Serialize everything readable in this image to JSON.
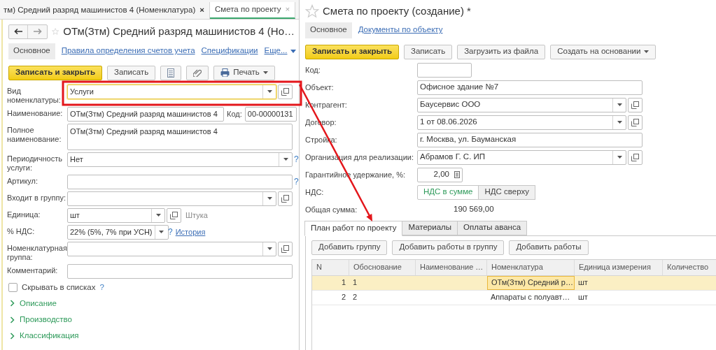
{
  "tab_bar": [
    {
      "label": "тм) Средний разряд машинистов 4 (Номенклатура)",
      "close": "×",
      "selected": false
    },
    {
      "label": "Смета по проекту",
      "close": "×",
      "selected": true
    }
  ],
  "left_form": {
    "title": "ОТм(Зтм) Средний разряд машинистов 4 (Но…",
    "nav": [
      {
        "label": "Основное",
        "selected": true
      },
      {
        "label": "Правила определения счетов учета",
        "selected": false
      },
      {
        "label": "Спецификации",
        "selected": false
      },
      {
        "label": "Еще...",
        "selected": false
      }
    ],
    "toolbar": [
      {
        "kind": "primary",
        "label": "Записать и закрыть"
      },
      {
        "kind": "plain",
        "label": "Записать"
      },
      {
        "kind": "list_icon"
      },
      {
        "kind": "clip_icon"
      },
      {
        "kind": "print",
        "label": "Печать"
      }
    ],
    "fields": [
      {
        "kind": "full",
        "label": "Вид номенклатуры:",
        "value": "Услуги",
        "dropdown": true,
        "open_button": true,
        "focused": true
      },
      {
        "kind": "with_code",
        "label": "Наименование:",
        "value": "ОТм(Зтм) Средний разряд машинистов 4",
        "code_label": "Код:",
        "code": "00-00000131",
        "focused": false
      },
      {
        "kind": "textarea",
        "label": "Полное наименование:",
        "value": "ОТм(Зтм) Средний разряд машинистов 4",
        "focused": false
      },
      {
        "kind": "full",
        "label": "Периодичность услуги:",
        "value": "Нет",
        "dropdown": true,
        "help": "?",
        "focused": false
      },
      {
        "kind": "full",
        "label": "Артикул:",
        "help": "?",
        "focused": false
      },
      {
        "kind": "full",
        "label": "Входит в группу:",
        "dropdown": true,
        "open_button": true,
        "focused": false
      },
      {
        "kind": "short",
        "label": "Единица:",
        "value": "шт",
        "dropdown": true,
        "open_button": true,
        "note": "Штука",
        "focused": false
      },
      {
        "kind": "short",
        "label": "% НДС:",
        "value": "22% (5%, 7% при УСН)",
        "dropdown": true,
        "help": "?",
        "link": "История",
        "focused": false
      },
      {
        "kind": "full",
        "label": "Номенклатурная группа:",
        "dropdown": true,
        "open_button": true,
        "focused": false
      },
      {
        "kind": "full",
        "label": "Комментарий:",
        "focused": false
      }
    ],
    "checkbox": {
      "label": "Скрывать в списках",
      "checked": false,
      "help": "?"
    },
    "sections": [
      {
        "label": "Описание",
        "expanded": false
      },
      {
        "label": "Производство",
        "expanded": false
      },
      {
        "label": "Классификация",
        "expanded": false
      }
    ]
  },
  "right_form": {
    "title": "Смета по проекту (создание) *",
    "nav": [
      {
        "label": "Основное",
        "selected": true
      },
      {
        "label": "Документы по объекту",
        "selected": false
      }
    ],
    "toolbar": [
      {
        "kind": "primary",
        "label": "Записать и закрыть"
      },
      {
        "kind": "plain",
        "label": "Записать"
      },
      {
        "kind": "plain",
        "label": "Загрузить из файла"
      },
      {
        "kind": "menu",
        "label": "Создать на основании"
      }
    ],
    "fields": [
      {
        "kind": "short",
        "label": "Код:"
      },
      {
        "kind": "full",
        "label": "Объект:",
        "value": "Офисное здание №7"
      },
      {
        "kind": "full",
        "label": "Контрагент:",
        "value": "Баусервис ООО",
        "dropdown": true,
        "open_button": true
      },
      {
        "kind": "full",
        "label": "Договор:",
        "value": "1 от 08.06.2026",
        "dropdown": true,
        "open_button": true
      },
      {
        "kind": "full",
        "label": "Стройка:",
        "value": "г. Москва, ул. Бауманская"
      },
      {
        "kind": "full",
        "label": "Организация для реализации:",
        "value": "Абрамов Г. С. ИП",
        "dropdown": true,
        "open_button": true
      },
      {
        "kind": "number",
        "label": "Гарантийное удержание, %:",
        "value": "2,00"
      },
      {
        "kind": "toggle",
        "label": "НДС:",
        "options": [
          {
            "label": "НДС в сумме",
            "selected": true
          },
          {
            "label": "НДС сверху",
            "selected": false
          }
        ]
      },
      {
        "kind": "readout",
        "label": "Общая сумма:",
        "value": "190 569,00"
      }
    ],
    "tabs": [
      {
        "label": "План работ по проекту",
        "selected": true
      },
      {
        "label": "Материалы",
        "selected": false
      },
      {
        "label": "Оплаты аванса",
        "selected": false
      }
    ],
    "table_buttons": [
      "Добавить группу",
      "Добавить работы в группу",
      "Добавить работы"
    ],
    "table": {
      "columns": [
        "N",
        "Обоснование",
        "Наименование …",
        "Номенклатура",
        "Единица измерения",
        "Количество"
      ],
      "rows": [
        {
          "n": "1",
          "basis": "1",
          "nomenclature": "ОТм(Зтм) Средний р…",
          "unit": "шт",
          "selected": true
        },
        {
          "n": "2",
          "basis": "2",
          "nomenclature": "Аппараты с полуавт…",
          "unit": "шт",
          "selected": false
        }
      ]
    }
  }
}
